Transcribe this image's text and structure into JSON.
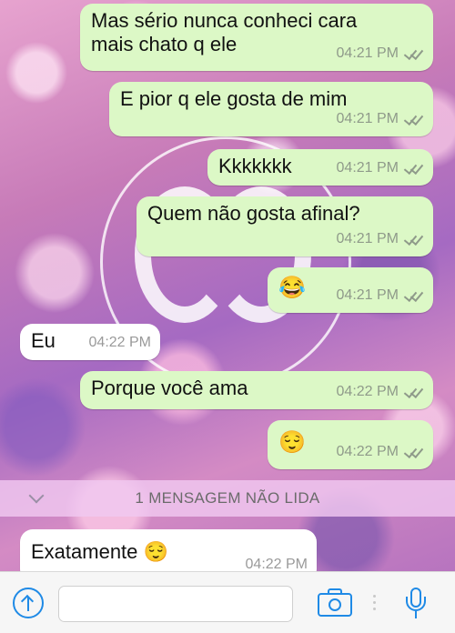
{
  "chat": {
    "messages": [
      {
        "direction": "outgoing",
        "lines": [
          "Mas sério nunca conheci cara",
          "mais chato q ele"
        ],
        "time": "04:21 PM",
        "status": "read-ticks"
      },
      {
        "direction": "outgoing",
        "lines": [
          "E pior q ele gosta de mim"
        ],
        "time": "04:21 PM",
        "status": "read-ticks"
      },
      {
        "direction": "outgoing",
        "lines": [
          "Kkkkkkk"
        ],
        "time": "04:21 PM",
        "status": "read-ticks"
      },
      {
        "direction": "outgoing",
        "lines": [
          "Quem não gosta afinal?"
        ],
        "time": "04:21 PM",
        "status": "read-ticks"
      },
      {
        "direction": "outgoing",
        "lines": [
          "😂"
        ],
        "time": "04:21 PM",
        "status": "read-ticks"
      },
      {
        "direction": "incoming",
        "lines": [
          "Eu"
        ],
        "time": "04:22 PM"
      },
      {
        "direction": "outgoing",
        "lines": [
          "Porque você ama"
        ],
        "time": "04:22 PM",
        "status": "read-ticks"
      },
      {
        "direction": "outgoing",
        "lines": [
          "😌"
        ],
        "time": "04:22 PM",
        "status": "read-ticks"
      },
      {
        "direction": "incoming",
        "lines": [
          "Exatamente 😌"
        ],
        "time": "04:22 PM"
      }
    ],
    "unread_divider": "1 MENSAGEM NÃO LIDA"
  },
  "composer": {
    "input_value": "",
    "icons": [
      "upload-arrow-icon",
      "camera-icon",
      "microphone-icon"
    ]
  },
  "colors": {
    "outgoing_bubble": "#dcf8c6",
    "incoming_bubble": "#ffffff",
    "accent": "#1f8ae6"
  }
}
